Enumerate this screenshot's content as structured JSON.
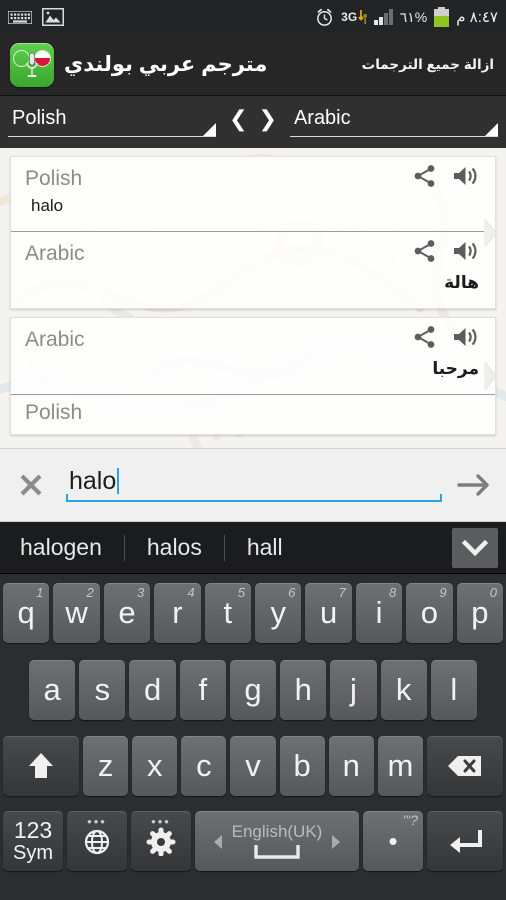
{
  "status_bar": {
    "left_icons": [
      "keyboard-icon",
      "image-icon"
    ],
    "alarm_icon": "alarm-clock-icon",
    "network_label": "3G",
    "signal_icon": "signal-bars-icon",
    "battery_percent": "٦١%",
    "battery_icon": "battery-icon",
    "time": "٨:٤٧ م"
  },
  "action_bar": {
    "app_icon": "app-logo-icon",
    "title": "مترجم عربي بولندي",
    "clear_all_label": "ازالة جميع الترجمات"
  },
  "language_bar": {
    "source": "Polish",
    "target": "Arabic",
    "swap_left": "❮",
    "swap_right": "❯"
  },
  "translations": [
    {
      "source_lang": "Polish",
      "source_text": "halo",
      "target_lang": "Arabic",
      "target_text": "هالة",
      "share_icon": "share-icon",
      "speak_icon": "speaker-icon"
    },
    {
      "source_lang": "Arabic",
      "source_text": "مرحبا",
      "target_lang": "Polish",
      "target_text": "",
      "share_icon": "share-icon",
      "speak_icon": "speaker-icon"
    }
  ],
  "input_row": {
    "clear_icon": "close-icon",
    "value": "halo",
    "placeholder": "",
    "send_icon": "arrow-right-icon"
  },
  "keyboard": {
    "suggestions": [
      "halogen",
      "halos",
      "hall"
    ],
    "expand_icon": "chevron-down-icon",
    "row1": [
      {
        "key": "q",
        "sup": "1"
      },
      {
        "key": "w",
        "sup": "2"
      },
      {
        "key": "e",
        "sup": "3"
      },
      {
        "key": "r",
        "sup": "4"
      },
      {
        "key": "t",
        "sup": "5"
      },
      {
        "key": "y",
        "sup": "6"
      },
      {
        "key": "u",
        "sup": "7"
      },
      {
        "key": "i",
        "sup": "8"
      },
      {
        "key": "o",
        "sup": "9"
      },
      {
        "key": "p",
        "sup": "0"
      }
    ],
    "row2": [
      "a",
      "s",
      "d",
      "f",
      "g",
      "h",
      "j",
      "k",
      "l"
    ],
    "row3": {
      "shift_icon": "shift-icon",
      "keys": [
        "z",
        "x",
        "c",
        "v",
        "b",
        "n",
        "m"
      ],
      "backspace_icon": "backspace-icon"
    },
    "row4": {
      "sym_line1": "123",
      "sym_line2": "Sym",
      "globe_icon": "globe-icon",
      "settings_icon": "gear-icon",
      "space_label": "English(UK)",
      "space_left_arrow": "◀",
      "space_right_arrow": "▶",
      "period_sup": "\"'?",
      "period_key": "•",
      "enter_icon": "enter-icon"
    }
  },
  "colors": {
    "accent": "#2aa3e8",
    "action_bar_bg": "#262626",
    "lang_bar_bg": "#303030",
    "list_bg": "#f4f3ef",
    "key_bg": "#6e7072",
    "battery_green": "#8fc31f"
  }
}
